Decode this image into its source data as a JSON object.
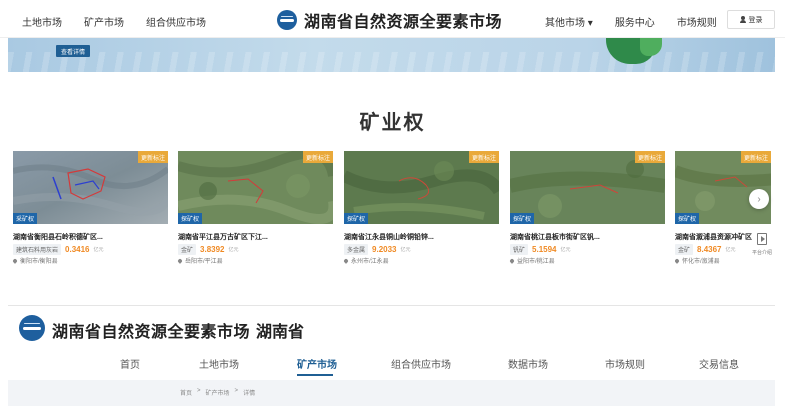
{
  "header": {
    "nav_left": [
      "土地市场",
      "矿产市场",
      "组合供应市场"
    ],
    "title": "湖南省自然资源全要素市场",
    "nav_right": [
      "其他市场 ▾",
      "服务中心",
      "市场规则"
    ],
    "login_label": "登录"
  },
  "banner": {
    "button_label": "查看详情"
  },
  "section": {
    "title": "矿业权"
  },
  "cards": [
    {
      "tag": "更新标注",
      "type": "采矿权",
      "title": "湖南省衡阳县石岭积德矿区...",
      "category": "建筑石料用灰岩",
      "price": "0.3416",
      "unit": "亿元",
      "location": "衡阳市/衡阳县"
    },
    {
      "tag": "更新标注",
      "type": "探矿权",
      "title": "湖南省平江县万古矿区下江...",
      "category": "金矿",
      "price": "3.8392",
      "unit": "亿元",
      "location": "岳阳市/平江县"
    },
    {
      "tag": "更新标注",
      "type": "探矿权",
      "title": "湖南省江永县铜山岭铜铅锌...",
      "category": "多金属",
      "price": "9.2033",
      "unit": "亿元",
      "location": "永州市/江永县"
    },
    {
      "tag": "更新标注",
      "type": "探矿权",
      "title": "湖南省桃江县板市街矿区钒...",
      "category": "钒矿",
      "price": "5.1594",
      "unit": "亿元",
      "location": "益阳市/桃江县"
    },
    {
      "tag": "更新标注",
      "type": "探矿权",
      "title": "湖南省溆浦县资源冲矿区",
      "category": "金矿",
      "price": "8.4367",
      "unit": "亿元",
      "location": "怀化市/溆浦县"
    }
  ],
  "side": {
    "label": "平台介绍"
  },
  "footer": {
    "title": "湖南省自然资源全要素市场",
    "subtitle": "湖南省",
    "nav": [
      "首页",
      "土地市场",
      "矿产市场",
      "组合供应市场",
      "数据市场",
      "市场规则",
      "交易信息"
    ],
    "active_index": 2,
    "breadcrumbs": [
      "首页",
      ">",
      "矿产市场",
      ">",
      "详情"
    ]
  },
  "colors": {
    "accent": "#1f5f94",
    "tag": "#e9a93a",
    "price": "#f08a24"
  },
  "icons": [
    "logo-icon",
    "user-icon",
    "pin-icon",
    "chevron-right-icon",
    "play-doc-icon"
  ]
}
